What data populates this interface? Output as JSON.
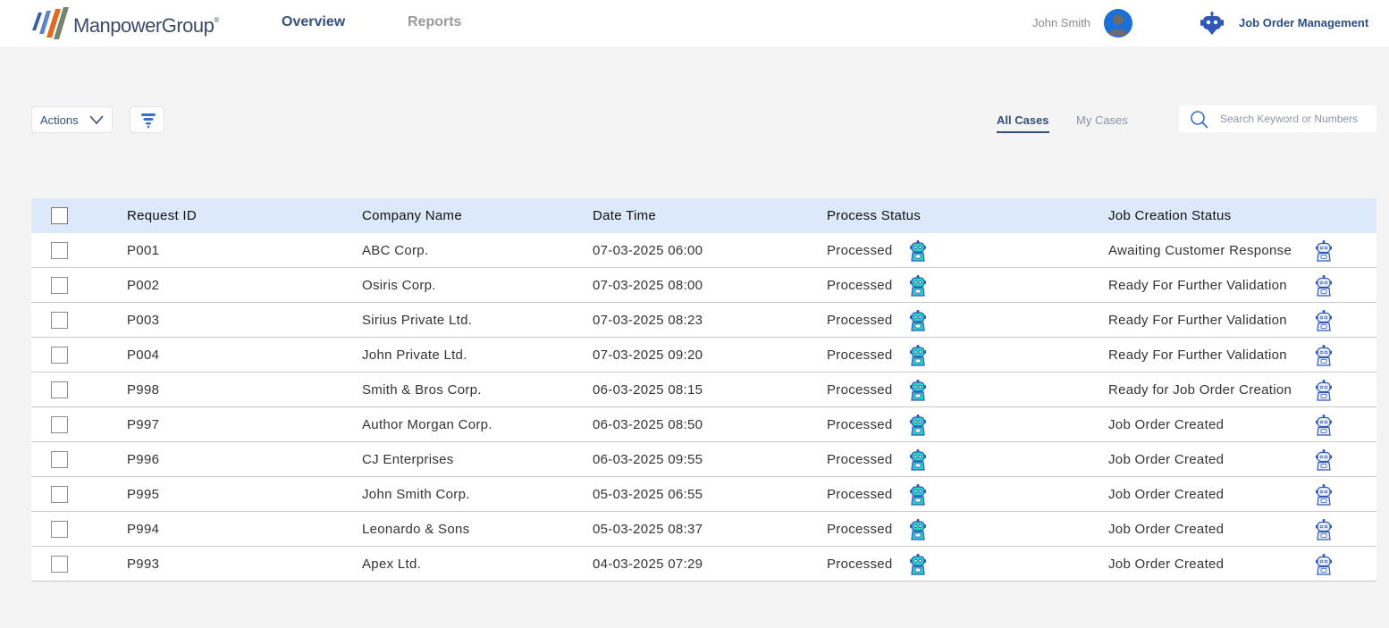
{
  "header": {
    "logo_text": "ManpowerGroup",
    "logo_trademark": "®",
    "nav": [
      {
        "label": "Overview",
        "active": true
      },
      {
        "label": "Reports",
        "active": false
      }
    ],
    "user_name": "John Smith",
    "app_name": "Job Order Management"
  },
  "toolbar": {
    "actions_label": "Actions",
    "tabs": [
      {
        "label": "All Cases",
        "active": true
      },
      {
        "label": "My Cases",
        "active": false
      }
    ],
    "search_placeholder": "Search Keyword or Numbers"
  },
  "table": {
    "columns": [
      "Request ID",
      "Company Name",
      "Date Time",
      "Process Status",
      "Job Creation Status"
    ],
    "rows": [
      {
        "id": "P001",
        "company": "ABC Corp.",
        "datetime": "07-03-2025 06:00",
        "process": "Processed",
        "job": "Awaiting Customer Response",
        "job_state": "awaiting"
      },
      {
        "id": "P002",
        "company": "Osiris Corp.",
        "datetime": "07-03-2025 08:00",
        "process": "Processed",
        "job": "Ready For Further Validation",
        "job_state": "normal"
      },
      {
        "id": "P003",
        "company": "Sirius Private Ltd.",
        "datetime": "07-03-2025 08:23",
        "process": "Processed",
        "job": "Ready For Further Validation",
        "job_state": "normal"
      },
      {
        "id": "P004",
        "company": "John Private Ltd.",
        "datetime": "07-03-2025 09:20",
        "process": "Processed",
        "job": "Ready For Further Validation",
        "job_state": "normal"
      },
      {
        "id": "P998",
        "company": "Smith & Bros Corp.",
        "datetime": "06-03-2025 08:15",
        "process": "Processed",
        "job": "Ready for Job Order Creation",
        "job_state": "normal"
      },
      {
        "id": "P997",
        "company": "Author Morgan Corp.",
        "datetime": "06-03-2025 08:50",
        "process": "Processed",
        "job": "Job Order Created",
        "job_state": "normal"
      },
      {
        "id": "P996",
        "company": "CJ Enterprises",
        "datetime": "06-03-2025 09:55",
        "process": "Processed",
        "job": "Job Order Created",
        "job_state": "normal"
      },
      {
        "id": "P995",
        "company": "John Smith Corp.",
        "datetime": "05-03-2025 06:55",
        "process": "Processed",
        "job": "Job Order Created",
        "job_state": "normal"
      },
      {
        "id": "P994",
        "company": "Leonardo & Sons",
        "datetime": "05-03-2025 08:37",
        "process": "Processed",
        "job": "Job Order Created",
        "job_state": "normal"
      },
      {
        "id": "P993",
        "company": "Apex Ltd.",
        "datetime": "04-03-2025 07:29",
        "process": "Processed",
        "job": "Job Order Created",
        "job_state": "normal"
      }
    ]
  },
  "colors": {
    "brand_navy": "#34507a",
    "header_row_bg": "#dbe9fb",
    "processed_green": "#1fb33e",
    "awaiting_orange": "#e6a31a",
    "bot_teal": "#29d3c6",
    "bot_outline": "#2e57b8"
  },
  "icons": {
    "process_status": "robot-icon",
    "job_status": "robot-outline-icon",
    "header_app": "bot-head-icon",
    "search": "search-icon",
    "filter": "filter-icon",
    "actions": "chevron-down-icon"
  }
}
